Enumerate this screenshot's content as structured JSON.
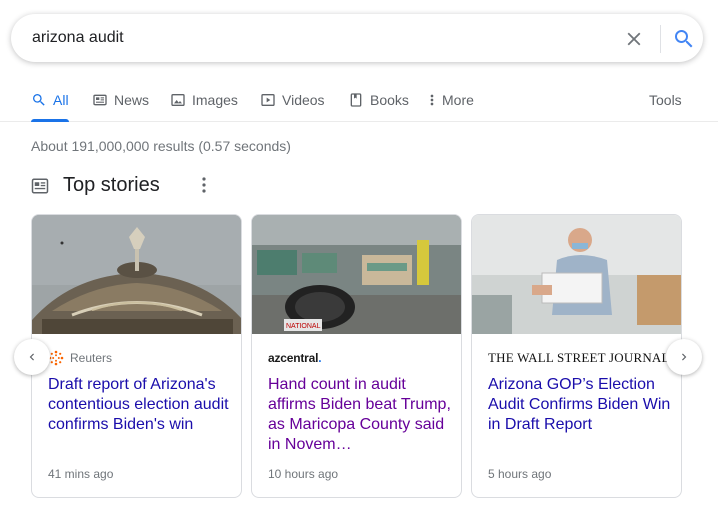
{
  "search": {
    "query": "arizona audit",
    "placeholder": ""
  },
  "tabs": [
    {
      "label": "All",
      "icon": "search-icon",
      "active": true
    },
    {
      "label": "News",
      "icon": "news-icon",
      "active": false
    },
    {
      "label": "Images",
      "icon": "image-icon",
      "active": false
    },
    {
      "label": "Videos",
      "icon": "video-icon",
      "active": false
    },
    {
      "label": "Books",
      "icon": "book-icon",
      "active": false
    },
    {
      "label": "More",
      "icon": "more-vert-icon",
      "active": false
    }
  ],
  "tools_label": "Tools",
  "result_stats": "About 191,000,000 results (0.57 seconds)",
  "top_stories": {
    "title": "Top stories",
    "cards": [
      {
        "source": "Reuters",
        "headline": "Draft report of Arizona's contentious election audit confirms Biden's win",
        "time": "41 mins ago",
        "visited": false
      },
      {
        "source_logo": [
          "azcentral",
          "."
        ],
        "headline": "Hand count in audit affirms Biden beat Trump, as Maricopa County said in Novem…",
        "time": "10 hours ago",
        "visited": true
      },
      {
        "source_logo": "THE WALL STREET JOURNAL.",
        "headline": "Arizona GOP’s Election Audit Confirms Biden Win in Draft Report",
        "time": "5 hours ago",
        "visited": false
      }
    ]
  },
  "colors": {
    "accent": "#1a73e8",
    "link": "#1a0dab",
    "visited": "#660099",
    "muted": "#70757a"
  }
}
